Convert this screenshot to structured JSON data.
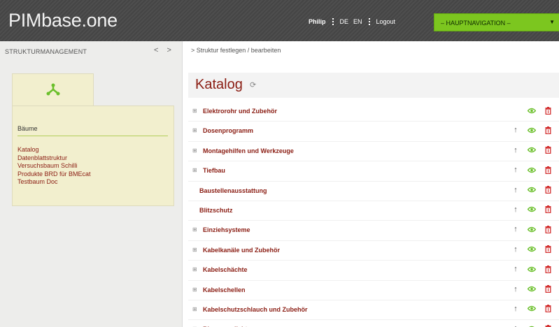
{
  "header": {
    "logo": "PIMbase.one",
    "user": "Philip",
    "lang_de": "DE",
    "lang_en": "EN",
    "logout": "Logout",
    "navigation": "– HAUPTNAVIGATION –"
  },
  "sidebar": {
    "heading": "STRUKTURMANAGEMENT",
    "prev_arrow": "<",
    "next_arrow": ">",
    "tab_icon": "tree-structure-icon",
    "panel_title": "Bäume",
    "trees": [
      "Katalog",
      "Datenblattstruktur",
      "Versuchsbaum Schilli",
      "Produkte BRD für BMEcat",
      "Testbaum Doc"
    ]
  },
  "main": {
    "breadcrumb": "> Struktur festlegen / bearbeiten",
    "title": "Katalog",
    "refresh_icon": "refresh-icon",
    "rows": [
      {
        "label": "Elektrorohr und Zubehör",
        "expandable": true,
        "up": false
      },
      {
        "label": "Dosenprogramm",
        "expandable": true,
        "up": true
      },
      {
        "label": "Montagehilfen und Werkzeuge",
        "expandable": true,
        "up": true
      },
      {
        "label": "Tiefbau",
        "expandable": true,
        "up": true
      },
      {
        "label": "Baustellenausstattung",
        "expandable": false,
        "up": true
      },
      {
        "label": "Blitzschutz",
        "expandable": false,
        "up": true
      },
      {
        "label": "Einziehsysteme",
        "expandable": true,
        "up": true
      },
      {
        "label": "Kabelkanäle und Zubehör",
        "expandable": true,
        "up": true
      },
      {
        "label": "Kabelschächte",
        "expandable": true,
        "up": true
      },
      {
        "label": "Kabelschellen",
        "expandable": true,
        "up": true
      },
      {
        "label": "Kabelschutzschlauch und Zubehör",
        "expandable": true,
        "up": true
      },
      {
        "label": "Ringraumdichtungen",
        "expandable": true,
        "up": true
      }
    ],
    "expand_glyph": "⊞",
    "up_glyph": "↑"
  },
  "colors": {
    "accent_green": "#7cc61f",
    "eye_green": "#6abf2a",
    "trash_red": "#d22b2b",
    "label_red": "#8a1c12"
  }
}
